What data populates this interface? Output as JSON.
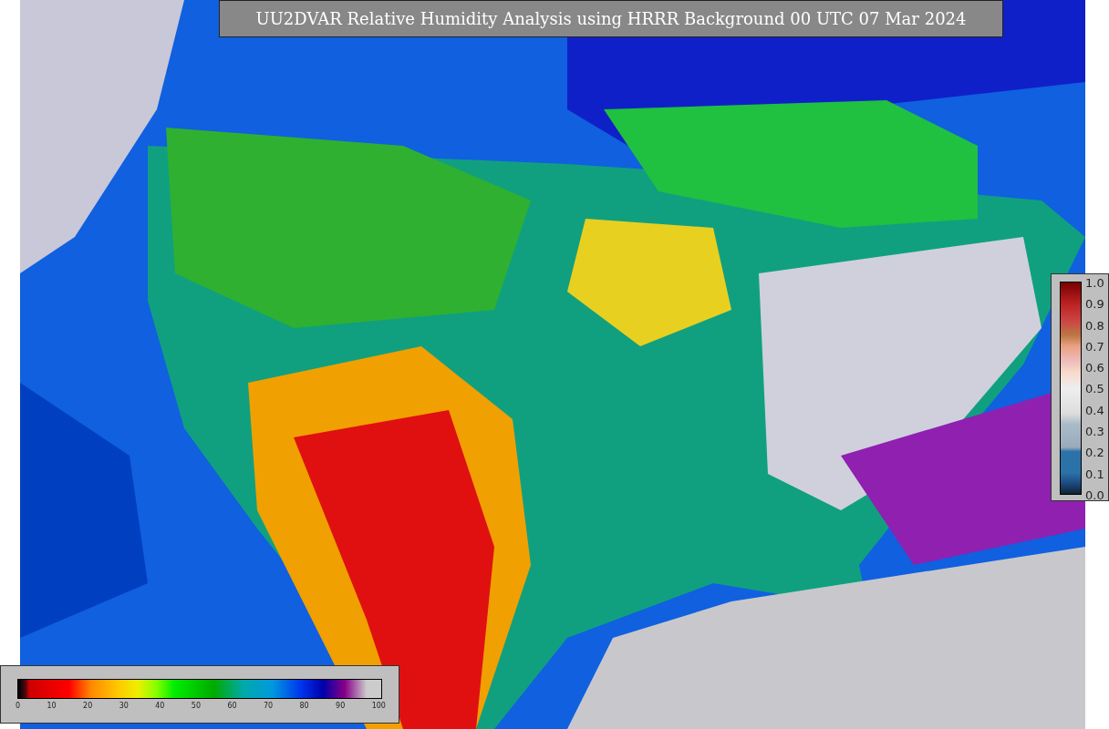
{
  "title": "UU2DVAR Relative Humidity Analysis using HRRR Background 00 UTC 07 Mar 2024",
  "humidity_colorbar": {
    "ticks": [
      "0",
      "10",
      "20",
      "30",
      "40",
      "50",
      "60",
      "70",
      "80",
      "90",
      "100"
    ]
  },
  "station_colorbar": {
    "ticks": [
      "1.0",
      "0.9",
      "0.8",
      "0.7",
      "0.6",
      "0.5",
      "0.4",
      "0.3",
      "0.2",
      "0.1",
      "0.0"
    ]
  }
}
